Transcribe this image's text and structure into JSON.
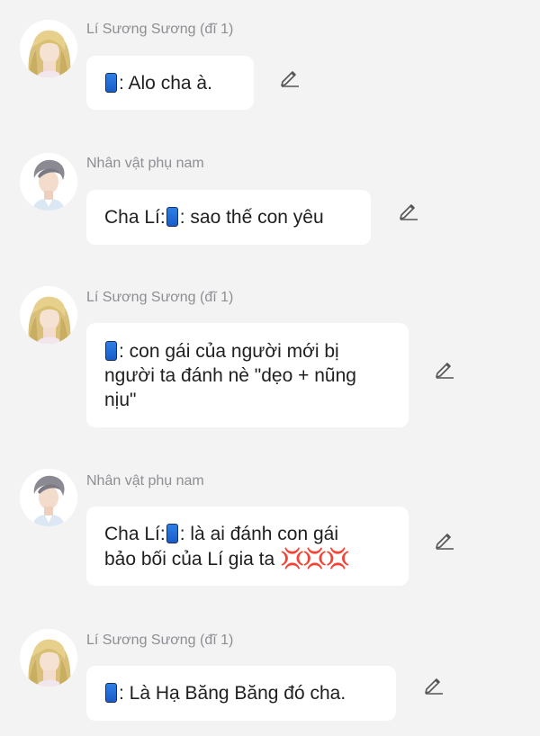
{
  "messages": [
    {
      "sender": "Lí Sương Sương (đĩ 1)",
      "role": "girl",
      "text": ": Alo cha à."
    },
    {
      "sender": "Nhân vật phụ nam",
      "role": "man",
      "prefix": "Cha Lí:",
      "text": ": sao thế con yêu"
    },
    {
      "sender": "Lí Sương Sương (đĩ 1)",
      "role": "girl",
      "text_lines": [
        ": con gái của người mới bị",
        "người ta đánh nè \"dẹo + nũng",
        "nịu\""
      ]
    },
    {
      "sender": "Nhân vật phụ nam",
      "role": "man",
      "prefix": "Cha Lí:",
      "text_lines": [
        ": là ai đánh con gái",
        "bảo bối của Lí gia ta"
      ],
      "emoji": "💢💢💢"
    },
    {
      "sender": "Lí Sương Sương (đĩ 1)",
      "role": "girl",
      "text": ": Là Hạ Băng Băng đó cha."
    }
  ],
  "icons": {
    "phone": "mobile-phone-emoji-icon",
    "anger": "anger-symbol-emoji",
    "edit": "pencil-edit-icon"
  },
  "colors": {
    "background": "#f3f3f4",
    "bubble": "#ffffff",
    "sender_text": "#8e8e93",
    "message_text": "#1f1f1f"
  }
}
